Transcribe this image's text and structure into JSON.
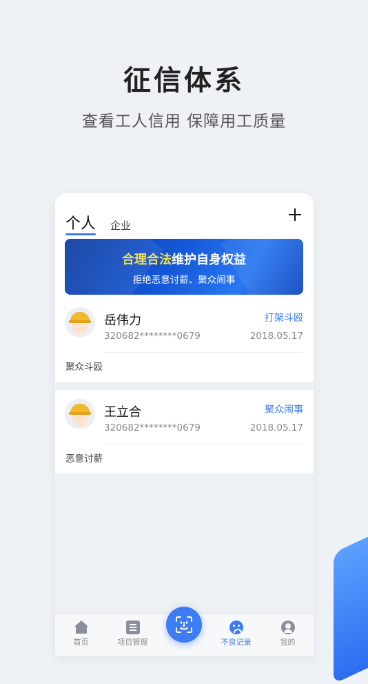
{
  "hero": {
    "title": "征信体系",
    "subtitle": "查看工人信用 保障用工质量"
  },
  "app": {
    "tabs": {
      "personal": "个人",
      "company": "企业"
    },
    "add_icon": "plus-icon",
    "banner": {
      "title_highlight": "合理合法",
      "title_rest": "维护自身权益",
      "subtitle": "拒绝恶意讨薪、聚众闹事"
    },
    "records": [
      {
        "name": "岳伟力",
        "id_number": "320682********0679",
        "tag": "打架斗殴",
        "date": "2018.05.17",
        "description": "聚众斗殴"
      },
      {
        "name": "王立合",
        "id_number": "320682********0679",
        "tag": "聚众闹事",
        "date": "2018.05.17",
        "description": "恶意讨薪"
      }
    ],
    "nav": {
      "items": [
        {
          "label": "首页",
          "icon": "home-icon"
        },
        {
          "label": "项目管理",
          "icon": "list-icon"
        },
        {
          "label": "",
          "icon": "face-scan-icon"
        },
        {
          "label": "不良记录",
          "icon": "sad-face-icon"
        },
        {
          "label": "我的",
          "icon": "user-icon"
        }
      ],
      "active_index": 3
    }
  },
  "colors": {
    "accent": "#3d7cf2",
    "highlight": "#f7e14a",
    "helmet": "#f3b72a",
    "background": "#eef1f5"
  }
}
